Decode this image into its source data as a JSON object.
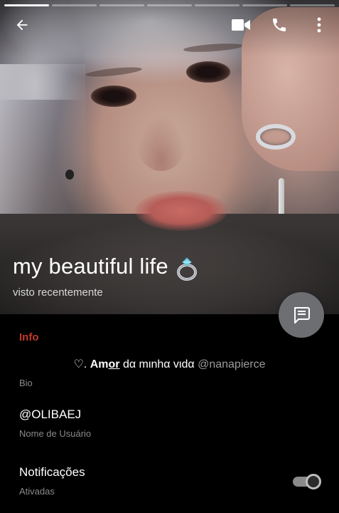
{
  "profile": {
    "name": "my beautiful life",
    "name_emoji_icon": "ring-icon",
    "status": "visto recentemente"
  },
  "top_bar": {
    "story_segments": 7,
    "active_segment": 1,
    "icons": [
      "back-arrow-icon",
      "video-camera-icon",
      "phone-icon",
      "more-vertical-icon"
    ]
  },
  "info": {
    "header": "Info",
    "bio": {
      "prefix": "♡. ",
      "bold_part": "Am",
      "underlined_part": "or",
      "rest": " dα mιnhα vιdα ",
      "mention": "@nanapierce",
      "label": "Bio"
    },
    "username": {
      "value": "@OLIBAEJ",
      "label": "Nome de Usuário"
    },
    "notifications": {
      "value": "Notificações",
      "label": "Ativadas",
      "enabled": true
    }
  },
  "colors": {
    "accent": "#c0392b",
    "fab": "#6d6e72",
    "background": "#000000",
    "label_gray": "#8a8a8a"
  }
}
